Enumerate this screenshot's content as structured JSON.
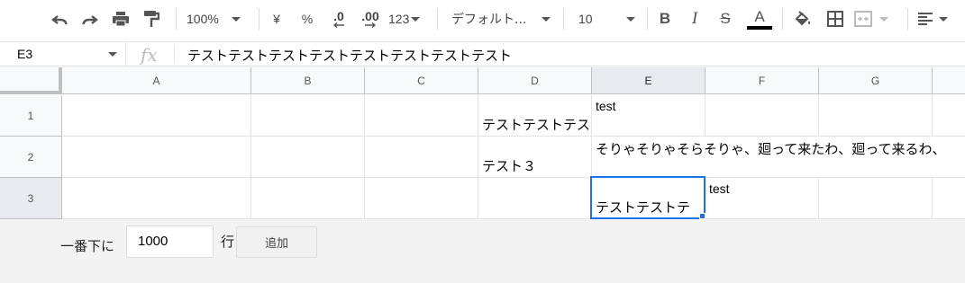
{
  "toolbar": {
    "zoom": "100%",
    "currency": "¥",
    "percent": "%",
    "decrease_decimal": ".0",
    "increase_decimal": ".00",
    "more_formats": "123",
    "font_family": "デフォルト...",
    "font_size": "10",
    "bold": "B",
    "italic": "I",
    "strikethrough": "S",
    "text_color": "A",
    "text_color_bar": "#000000"
  },
  "formula_bar": {
    "cell_ref": "E3",
    "fx_label": "fx",
    "value": "テストテストテストテストテストテストテストテスト"
  },
  "grid": {
    "columns": [
      "A",
      "B",
      "C",
      "D",
      "E",
      "F",
      "G"
    ],
    "rows": [
      "1",
      "2",
      "3"
    ],
    "selected_column": "E",
    "selected_row": "3",
    "cells": {
      "D1": "テストテストテス",
      "E1": "test",
      "E2": "そりゃそりゃそらそりゃ、廻って来たわ、廻って来るわ、",
      "D2": "テスト３",
      "E3": "テストテストテ",
      "F3": "test"
    },
    "accent_color": "#1a73e8"
  },
  "footer": {
    "label": "一番下に",
    "row_count": "1000",
    "unit": "行",
    "add_button": "追加"
  }
}
